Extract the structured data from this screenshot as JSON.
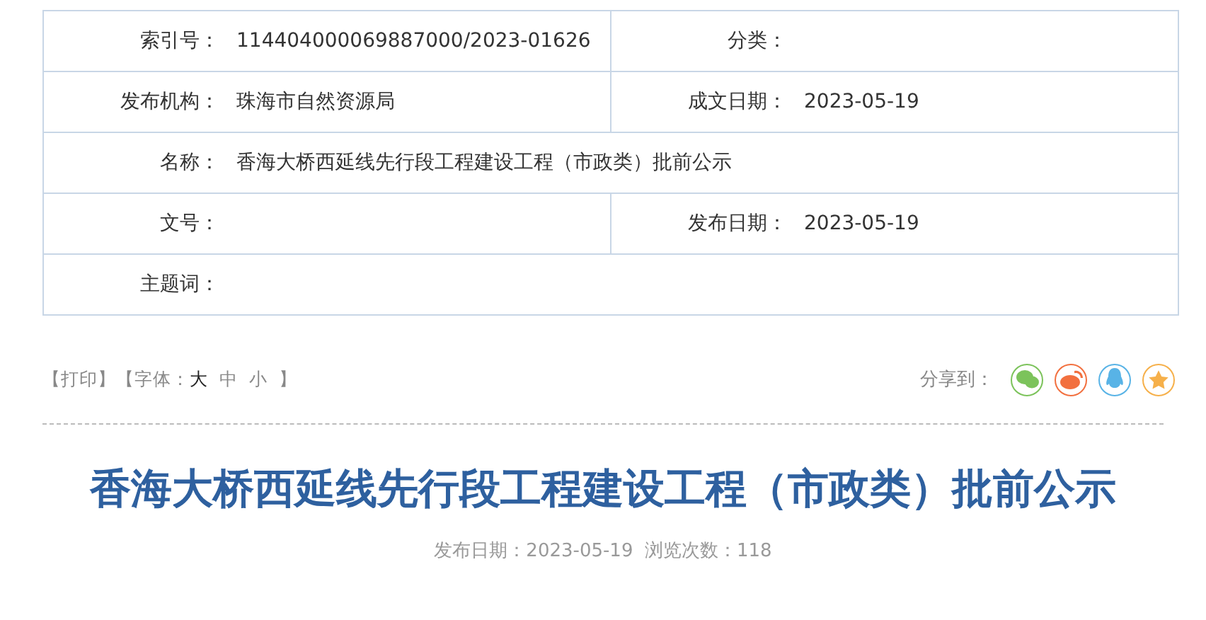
{
  "info_table": {
    "rows": [
      {
        "cells": [
          {
            "label": "索引号：",
            "value": "114404000069887000/2023-01626"
          },
          {
            "label": "分类："
          }
        ]
      },
      {
        "cells": [
          {
            "label": "发布机构：",
            "value": "珠海市自然资源局"
          },
          {
            "label": "成文日期：",
            "value": "2023-05-19"
          }
        ]
      },
      {
        "cells": [
          {
            "label": "名称：",
            "value": "香海大桥西延线先行段工程建设工程（市政类）批前公示"
          }
        ]
      },
      {
        "cells": [
          {
            "label": "文号："
          },
          {
            "label": "发布日期：",
            "value": "2023-05-19"
          }
        ]
      },
      {
        "cells": [
          {
            "label": "主题词："
          }
        ]
      }
    ]
  },
  "toolbar": {
    "print": "【打印】",
    "font_label": "【字体：",
    "font_sizes": [
      {
        "label": "大",
        "selected": true
      },
      {
        "label": "中",
        "selected": false
      },
      {
        "label": "小",
        "selected": false
      }
    ],
    "font_close": "】",
    "share_label": "分享到：",
    "share": [
      {
        "kind": "chat",
        "color": "#7cc35b"
      },
      {
        "kind": "weibo",
        "color": "#f2703f"
      },
      {
        "kind": "penguin",
        "color": "#58b3e6"
      },
      {
        "kind": "star",
        "color": "#f6b04a"
      }
    ]
  },
  "article": {
    "title": "香海大桥西延线先行段工程建设工程（市政类）批前公示",
    "meta": "发布日期：2023-05-19  浏览次数：118"
  }
}
